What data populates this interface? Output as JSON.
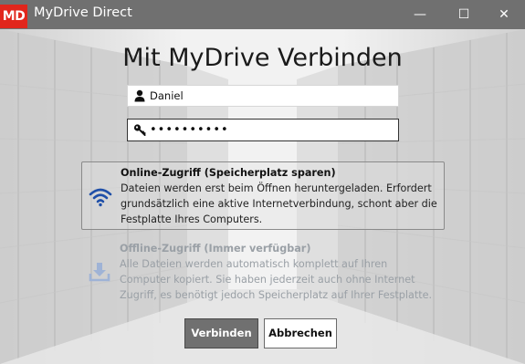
{
  "window": {
    "logo_text": "MD",
    "title": "MyDrive Direct",
    "controls": {
      "minimize": "—",
      "maximize": "☐",
      "close": "✕"
    }
  },
  "dialog": {
    "heading": "Mit MyDrive Verbinden",
    "username": {
      "value": "Daniel",
      "icon": "user-icon"
    },
    "password": {
      "value": "••••••••••",
      "icon": "key-icon"
    },
    "options": [
      {
        "title": "Online-Zugriff (Speicherplatz sparen)",
        "description": "Dateien werden erst beim Öffnen heruntergeladen. Erfordert grundsätzlich eine aktive Internetverbindung, schont aber die Festplatte Ihres Computers.",
        "icon": "wifi-icon",
        "selected": true
      },
      {
        "title": "Offline-Zugriff (Immer verfügbar)",
        "description": "Alle Dateien werden automatisch komplett auf Ihren Computer kopiert. Sie haben jederzeit auch ohne Internet Zugriff, es benötigt jedoch Speicherplatz auf Ihrer Festplatte.",
        "icon": "download-icon",
        "selected": false
      }
    ],
    "buttons": {
      "connect": "Verbinden",
      "cancel": "Abbrechen"
    }
  },
  "colors": {
    "titlebar": "#707070",
    "logo": "#e1261c",
    "accent_icon": "#1f4fa8",
    "disabled_icon": "#9fb3d6",
    "disabled_text": "#9aa0a6"
  }
}
